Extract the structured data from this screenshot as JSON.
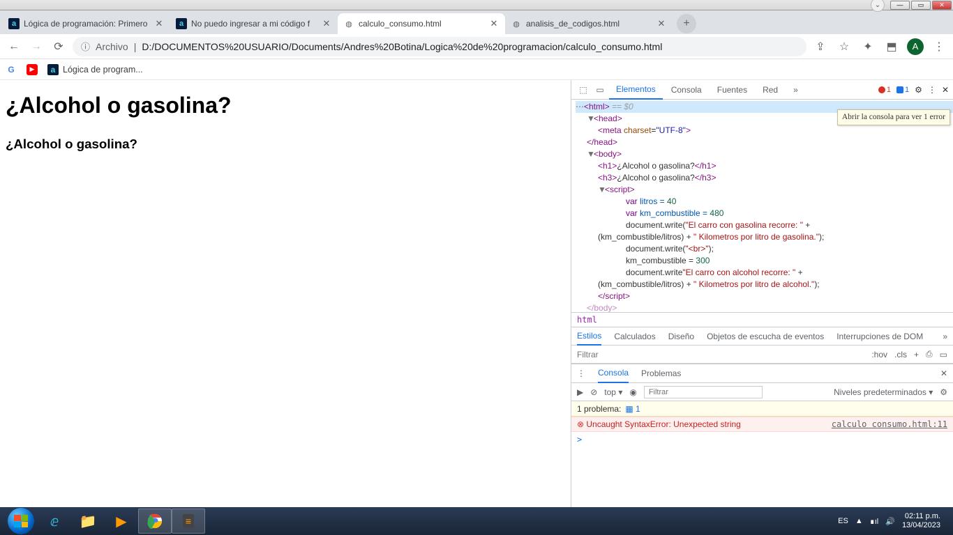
{
  "window": {
    "min": "—",
    "max": "▭",
    "close": "✕",
    "dropdown": "⌄"
  },
  "tabs": [
    {
      "title": "Lógica de programación: Primero",
      "favicon": "a"
    },
    {
      "title": "No puedo ingresar a mi código f",
      "favicon": "a"
    },
    {
      "title": "calculo_consumo.html",
      "favicon": "◍",
      "active": true
    },
    {
      "title": "analisis_de_codigos.html",
      "favicon": "◍"
    }
  ],
  "newtab": "+",
  "addr": {
    "info_icon": "ⓘ",
    "scheme": "Archivo",
    "sep": "|",
    "url": "D:/DOCUMENTOS%20USUARIO/Documents/Andres%20Botina/Logica%20de%20programacion/calculo_consumo.html",
    "share": "⇪",
    "star": "☆",
    "ext": "✦",
    "update": "⬒",
    "avatar": "A",
    "menu": "⋮"
  },
  "nav": {
    "back": "←",
    "forward": "→",
    "reload": "⟳"
  },
  "bookmarks": [
    {
      "icon": "G",
      "color": "#ea4335"
    },
    {
      "icon": "▶",
      "color": "#ff0000"
    },
    {
      "icon": "a",
      "bg": "#051d3b",
      "fg": "#4dd0e1",
      "label": "Lógica de program..."
    }
  ],
  "page": {
    "h1": "¿Alcohol o gasolina?",
    "h3": "¿Alcohol o gasolina?"
  },
  "devtools": {
    "tabs": [
      "Elementos",
      "Consola",
      "Fuentes",
      "Red"
    ],
    "more": "»",
    "errors": "1",
    "issues": "1",
    "gear": "⚙",
    "kebab": "⋮",
    "close": "✕",
    "select_icon": "⬚",
    "device_icon": "▭",
    "tooltip": "Abrir la consola para ver 1 error",
    "html_sel": "<html>",
    "eq0": " == $0",
    "crumb": "html",
    "styles_tabs": [
      "Estilos",
      "Calculados",
      "Diseño",
      "Objetos de escucha de eventos",
      "Interrupciones de DOM"
    ],
    "styles_more": "»",
    "filter_placeholder": "Filtrar",
    "hov": ":hov",
    "cls": ".cls",
    "plus": "+",
    "console_tabs": [
      "Consola",
      "Problemas"
    ],
    "console_close": "✕",
    "top": "top ▾",
    "eye": "◉",
    "levels": "Niveles predeterminados ▾",
    "cons_gear": "⚙",
    "problem_label": "1 problema:",
    "problem_count": "1",
    "error_msg": "Uncaught SyntaxError: Unexpected string",
    "error_src": "calculo consumo.html:11",
    "prompt": ">",
    "src": {
      "l1a": "<head>",
      "l2": "<meta charset=\"UTF-8\">",
      "l3": "</head>",
      "l4": "<body>",
      "l5a": "<h1>",
      "l5b": "¿Alcohol o gasolina?",
      "l5c": "</h1>",
      "l6a": "<h3>",
      "l6b": "¿Alcohol o gasolina?",
      "l6c": "</h3>",
      "l7": "<script>",
      "l8a": "var",
      "l8b": " litros = ",
      "l8c": "40",
      "l9a": "var",
      "l9b": " km_combustible = ",
      "l9c": "480",
      "l10a": "document.write(",
      "l10b": "\"El carro con gasolina recorre: \"",
      "l10c": " + ",
      "l11a": "(km_combustible/litros) + ",
      "l11b": "\" Kilometros por litro de gasolina.\"",
      "l11c": ");",
      "l12a": "document.write(",
      "l12b": "\"<br>\"",
      "l12c": ");",
      "l13a": "km_combustible = ",
      "l13b": "300",
      "l14a": "document.write",
      "l14b": "\"El carro con alcohol recorre: \"",
      "l14c": " + ",
      "l15a": "(km_combustible/litros) + ",
      "l15b": "\" Kilometros por litro de alcohol.\"",
      "l15c": ");",
      "l16": "</script>",
      "l17": "</body>"
    }
  },
  "taskbar": {
    "lang": "ES",
    "up": "▲",
    "net": "∎ıl",
    "vol": "🔊",
    "time": "02:11 p.m.",
    "date": "13/04/2023"
  }
}
